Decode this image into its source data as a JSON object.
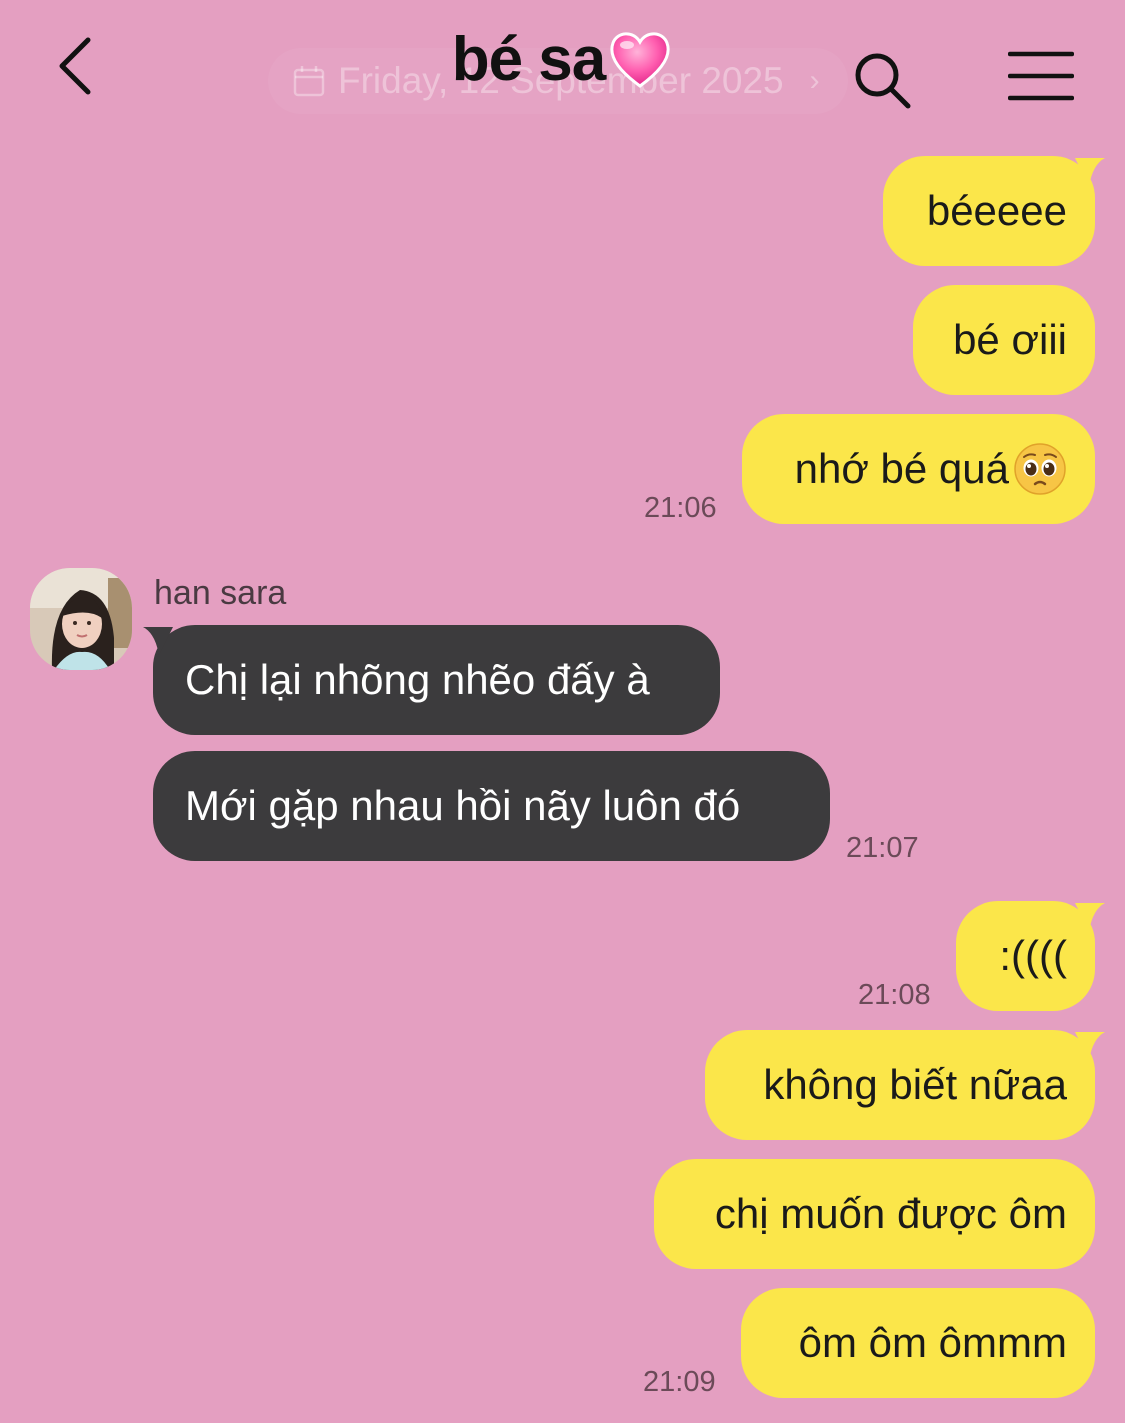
{
  "header": {
    "title": "bé sa",
    "title_emoji": "pink-heart",
    "date_pill": "Friday, 12 September 2025",
    "back_icon": "chevron-left-icon",
    "search_icon": "search-icon",
    "menu_icon": "hamburger-menu-icon"
  },
  "colors": {
    "background": "#e49fc1",
    "sent_bubble": "#fbe64a",
    "received_bubble": "#3c3b3d"
  },
  "contact": {
    "name": "han sara"
  },
  "messages": [
    {
      "from": "me",
      "text": "béeeee"
    },
    {
      "from": "me",
      "text": "bé ơiii"
    },
    {
      "from": "me",
      "text": "nhớ bé quá",
      "emoji": "pleading-face",
      "time": "21:06"
    },
    {
      "from": "han sara",
      "text": "Chị lại nhõng nhẽo đấy à"
    },
    {
      "from": "han sara",
      "text": "Mới gặp nhau hồi nãy luôn đó",
      "time": "21:07"
    },
    {
      "from": "me",
      "text": ":((((",
      "time": "21:08"
    },
    {
      "from": "me",
      "text": "không biết nữaa"
    },
    {
      "from": "me",
      "text": "chị muốn được ôm"
    },
    {
      "from": "me",
      "text": "ôm ôm ômmm",
      "time": "21:09"
    }
  ]
}
